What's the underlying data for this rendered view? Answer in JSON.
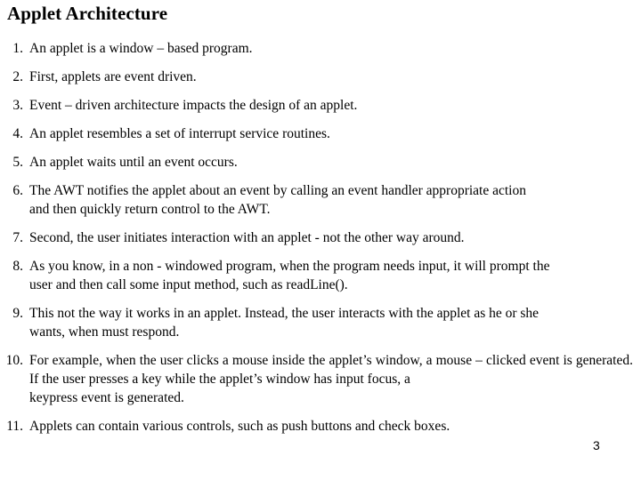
{
  "slide": {
    "title": "Applet Architecture",
    "page_number": "3",
    "background_color": "#ffffff",
    "text_color": "#000000"
  },
  "list": {
    "items": [
      {
        "number": "1.",
        "text": "An applet is a window – based program.",
        "lines": 1
      },
      {
        "number": "2.",
        "text": "First, applets are event driven.",
        "lines": 1
      },
      {
        "number": "3.",
        "text": "Event – driven architecture impacts the design of an applet.",
        "lines": 1
      },
      {
        "number": "4.",
        "text": "An applet resembles a set of interrupt service routines.",
        "lines": 1
      },
      {
        "number": "5.",
        "text": "An applet waits until an event occurs.",
        "lines": 1
      },
      {
        "number": "6.",
        "text": "The AWT notifies the applet about an event by calling an event handler appropriate action",
        "text_last": "and then quickly return control to the AWT.",
        "lines": 2
      },
      {
        "number": "7.",
        "text": "Second, the user initiates interaction with an applet - not the other way around.",
        "lines": 1
      },
      {
        "number": "8.",
        "text": "As you know, in a non - windowed program, when the program needs input, it will prompt the",
        "text_last": "user and then call some input method, such as readLine().",
        "lines": 2
      },
      {
        "number": "9.",
        "text": "This not the way it works in an applet. Instead, the user interacts with the applet as he or she",
        "text_last": "wants, when must respond.",
        "lines": 2
      },
      {
        "number": "10.",
        "text": "For example, when the user clicks a mouse inside the applet’s window, a mouse – clicked event is generated. If the user presses a key while the applet’s window has input focus, a",
        "text_last": "keypress event is generated.",
        "lines": 3
      },
      {
        "number": "11.",
        "text": "Applets can contain various controls, such as push buttons and check boxes.",
        "lines": 1
      }
    ]
  }
}
